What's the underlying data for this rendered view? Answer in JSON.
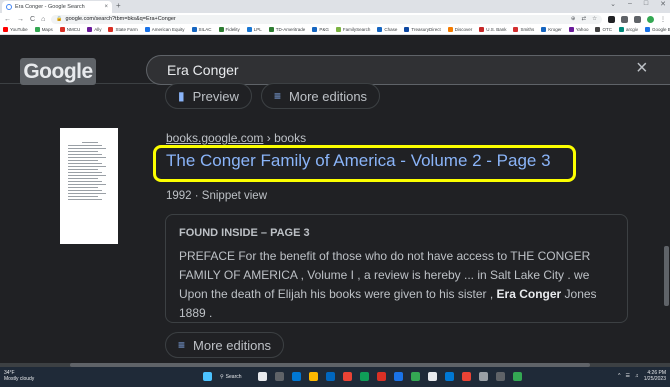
{
  "browser": {
    "tab_title": "Era Conger - Google Search",
    "tab_close": "×",
    "new_tab": "+",
    "window_controls": [
      "⌄",
      "–",
      "□",
      "✕"
    ],
    "nav": {
      "back": "←",
      "forward": "→",
      "reload": "C",
      "home": "⌂"
    },
    "url": "google.com/search?tbm=bks&q=Era+Conger",
    "omnibox_icons": [
      "⊕",
      "⇄",
      "☆"
    ]
  },
  "bookmarks": [
    {
      "label": "YouTube",
      "color": "#ff0000"
    },
    {
      "label": "Maps",
      "color": "#34a853"
    },
    {
      "label": "NMCU",
      "color": "#d93025"
    },
    {
      "label": "Ally",
      "color": "#6a1b9a"
    },
    {
      "label": "State Farm",
      "color": "#d93025"
    },
    {
      "label": "American Equity",
      "color": "#1a73e8"
    },
    {
      "label": "SILAC",
      "color": "#1565c0"
    },
    {
      "label": "Fidelity",
      "color": "#2e7d32"
    },
    {
      "label": "LPL",
      "color": "#1976d2"
    },
    {
      "label": "TD-Ameritrade",
      "color": "#2e7d32"
    },
    {
      "label": "P&G",
      "color": "#1565c0"
    },
    {
      "label": "FamilySearch",
      "color": "#7cb342"
    },
    {
      "label": "Chase",
      "color": "#1565c0"
    },
    {
      "label": "TreasuryDirect",
      "color": "#0d47a1"
    },
    {
      "label": "Discover",
      "color": "#f57c00"
    },
    {
      "label": "U.S. Bank",
      "color": "#c62828"
    },
    {
      "label": "Smiths",
      "color": "#d32f2f"
    },
    {
      "label": "Kroger",
      "color": "#1565c0"
    },
    {
      "label": "Yahoo",
      "color": "#6a1b9a"
    },
    {
      "label": "OTC",
      "color": "#424242"
    },
    {
      "label": "arcgiv",
      "color": "#00897b"
    },
    {
      "label": "Google Books",
      "color": "#1a73e8"
    }
  ],
  "google": {
    "logo_text": "Google",
    "search_query": "Era Conger",
    "clear_icon": "×"
  },
  "results": {
    "top_buttons": {
      "preview": "Preview",
      "more_editions": "More editions"
    },
    "cite_domain": "books.google.com",
    "cite_path": " › books",
    "title": "The Conger Family of America - Volume 2 - Page 3",
    "meta": "1992 · Snippet view",
    "found_inside_label": "FOUND INSIDE – PAGE 3",
    "snippet_part1": "PREFACE For the benefit of those who do not have access to THE CONGER FAMILY OF AMERICA , Volume I , a review is hereby ... in Salt Lake City . we Upon the death of Elijah his books were given to his sister , ",
    "snippet_bold": "Era Conger",
    "snippet_part2": " Jones 1889 .",
    "bottom_button": "More editions"
  },
  "taskbar": {
    "weather_temp": "34°F",
    "weather_desc": "Mostly cloudy",
    "search_label": "Search",
    "time": "4:26 PM",
    "date": "1/25/2023"
  },
  "colors": {
    "highlight": "#fcff00",
    "link": "#8ab4f8",
    "background": "#202124"
  }
}
